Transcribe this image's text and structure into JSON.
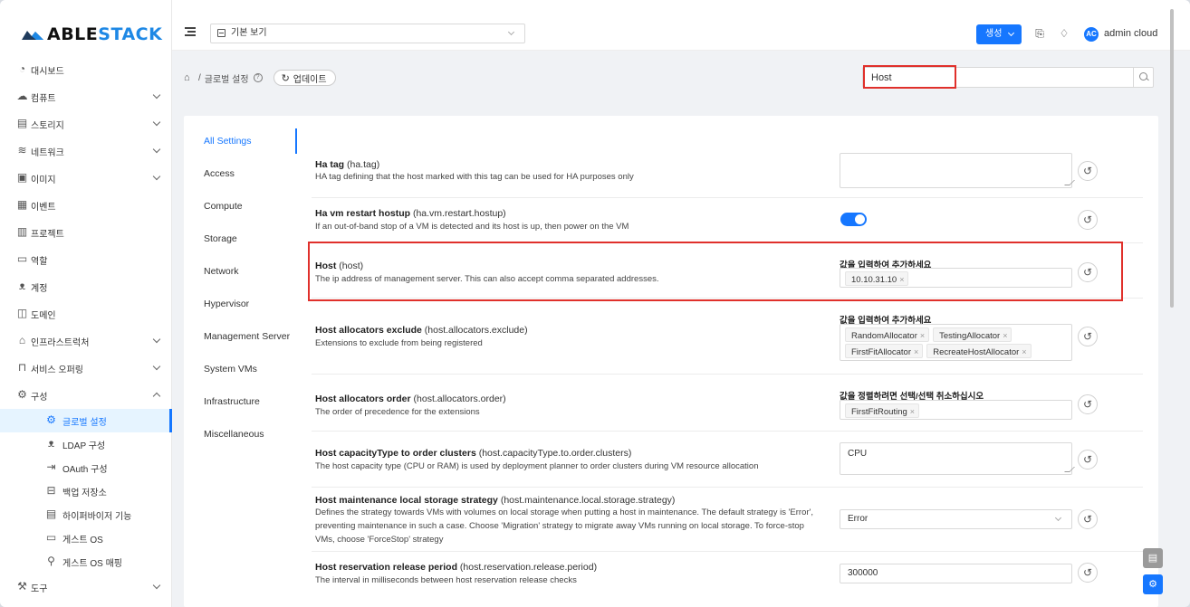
{
  "brand": {
    "logo_text_dark": "ABLE",
    "logo_text_blue": "STACK",
    "logo_colors": {
      "dark": "#1f3b5c",
      "blue": "#1e88e5"
    }
  },
  "topbar": {
    "view_select_value": "기본 보기",
    "create_button_label": "생성",
    "username": "admin cloud",
    "avatar_initials": "AC",
    "accent_color": "#1677ff"
  },
  "sidebar": {
    "items": [
      {
        "label": "대시보드",
        "icon": "dashboard-icon",
        "expandable": false
      },
      {
        "label": "컴퓨트",
        "icon": "cloud-icon",
        "expandable": true
      },
      {
        "label": "스토리지",
        "icon": "storage-icon",
        "expandable": true
      },
      {
        "label": "네트워크",
        "icon": "wifi-icon",
        "expandable": true
      },
      {
        "label": "이미지",
        "icon": "image-icon",
        "expandable": true
      },
      {
        "label": "이벤트",
        "icon": "calendar-icon",
        "expandable": false
      },
      {
        "label": "프로젝트",
        "icon": "project-icon",
        "expandable": false
      },
      {
        "label": "역할",
        "icon": "id-card-icon",
        "expandable": false
      },
      {
        "label": "계정",
        "icon": "users-icon",
        "expandable": false
      },
      {
        "label": "도메인",
        "icon": "domain-icon",
        "expandable": false
      },
      {
        "label": "인프라스트럭처",
        "icon": "bank-icon",
        "expandable": true
      },
      {
        "label": "서비스 오퍼링",
        "icon": "shopping-icon",
        "expandable": true
      },
      {
        "label": "구성",
        "icon": "settings-icon",
        "expandable": true,
        "expanded": true
      }
    ],
    "sub_items": [
      {
        "label": "글로벌 설정",
        "icon": "settings-icon",
        "active": true
      },
      {
        "label": "LDAP 구성",
        "icon": "users-icon"
      },
      {
        "label": "OAuth 구성",
        "icon": "login-icon"
      },
      {
        "label": "백업 저장소",
        "icon": "archive-icon"
      },
      {
        "label": "하이퍼바이저 기능",
        "icon": "file-icon"
      },
      {
        "label": "게스트 OS",
        "icon": "desktop-icon"
      },
      {
        "label": "게스트 OS 매핑",
        "icon": "link-icon"
      }
    ],
    "bottom_item": {
      "label": "도구",
      "icon": "tool-icon",
      "expandable": true
    }
  },
  "breadcrumb": {
    "root": "/",
    "current": "글로벌 설정",
    "update_button": "업데이트"
  },
  "search": {
    "value": "Host"
  },
  "categories": [
    "All Settings",
    "Access",
    "Compute",
    "Storage",
    "Network",
    "Hypervisor",
    "Management Server",
    "System VMs",
    "Infrastructure",
    "Miscellaneous"
  ],
  "settings": [
    {
      "title": "Ha tag",
      "key": "(ha.tag)",
      "desc": "HA tag defining that the host marked with this tag can be used for HA purposes only",
      "control": "textarea",
      "value": ""
    },
    {
      "title": "Ha vm restart hostup",
      "key": "(ha.vm.restart.hostup)",
      "desc": "If an out-of-band stop of a VM is detected and its host is up, then power on the VM",
      "control": "toggle",
      "value": "on"
    },
    {
      "title": "Host",
      "key": "(host)",
      "desc": "The ip address of management server. This can also accept comma separated addresses.",
      "control": "tags",
      "label": "값을 입력하여 추가하세요",
      "tags": [
        "10.10.31.10"
      ]
    },
    {
      "title": "Host allocators exclude",
      "key": "(host.allocators.exclude)",
      "desc": "Extensions to exclude from being registered",
      "control": "tags",
      "label": "값을 입력하여 추가하세요",
      "tags": [
        "RandomAllocator",
        "TestingAllocator",
        "FirstFitAllocator",
        "RecreateHostAllocator"
      ]
    },
    {
      "title": "Host allocators order",
      "key": "(host.allocators.order)",
      "desc": "The order of precedence for the extensions",
      "control": "tags",
      "label": "값을 정렬하려면 선택/선택 취소하십시오",
      "tags": [
        "FirstFitRouting"
      ]
    },
    {
      "title": "Host capacityType to order clusters",
      "key": "(host.capacityType.to.order.clusters)",
      "desc": "The host capacity type (CPU or RAM) is used by deployment planner to order clusters during VM resource allocation",
      "control": "textarea",
      "value": "CPU"
    },
    {
      "title": "Host maintenance local storage strategy",
      "key": "(host.maintenance.local.storage.strategy)",
      "desc_lines": [
        "Defines the strategy towards VMs with volumes on local storage when putting a host in maintenance. The default strategy is 'Error',",
        "preventing maintenance in such a case. Choose 'Migration' strategy to migrate away VMs running on local storage. To force-stop",
        "VMs, choose 'ForceStop' strategy"
      ],
      "control": "select",
      "value": "Error"
    },
    {
      "title": "Host reservation release period",
      "key": "(host.reservation.release.period)",
      "desc": "The interval in milliseconds between host reservation release checks",
      "control": "input",
      "value": "300000"
    }
  ],
  "highlight_color": "#e0302b"
}
